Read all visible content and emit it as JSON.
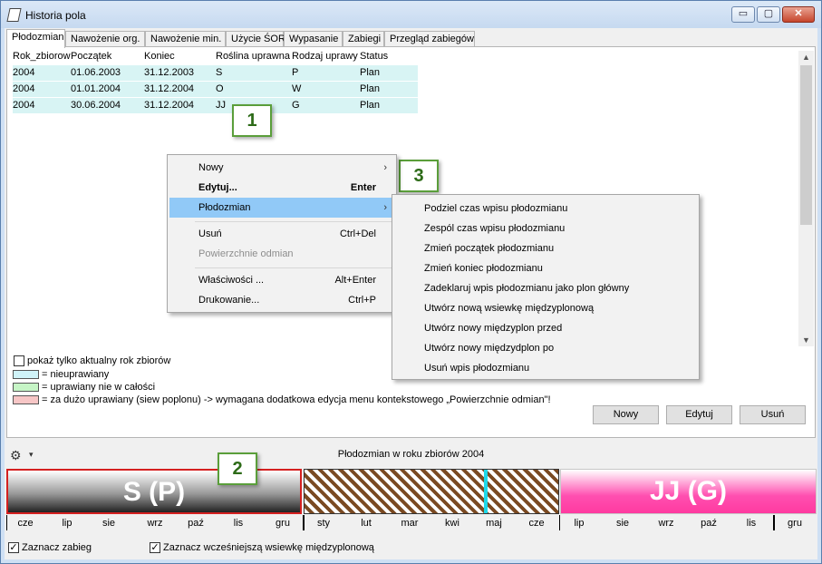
{
  "window": {
    "title": "Historia pola",
    "min_glyph": "▭",
    "max_glyph": "▢",
    "close_glyph": "✕"
  },
  "tabs": [
    {
      "label": "Płodozmian",
      "active": true
    },
    {
      "label": "Nawożenie org."
    },
    {
      "label": "Nawożenie min."
    },
    {
      "label": "Użycie ŚOR"
    },
    {
      "label": "Wypasanie"
    },
    {
      "label": "Zabiegi"
    },
    {
      "label": "Przegląd zabiegów"
    }
  ],
  "table": {
    "columns": [
      "Rok_zbiorow",
      "Początek",
      "Koniec",
      "Roślina uprawna",
      "Rodzaj uprawy",
      "Status"
    ],
    "rows": [
      [
        "2004",
        "01.06.2003",
        "31.12.2003",
        "S",
        "P",
        "Plan"
      ],
      [
        "2004",
        "01.01.2004",
        "31.12.2004",
        "O",
        "W",
        "Plan"
      ],
      [
        "2004",
        "30.06.2004",
        "31.12.2004",
        "JJ",
        "G",
        "Plan"
      ]
    ],
    "row_color": "#d8f4f4"
  },
  "markers": {
    "m1": "1",
    "m2": "2",
    "m3": "3"
  },
  "context_menu": {
    "items": [
      {
        "label": "Nowy",
        "shortcut": "",
        "submenu": true
      },
      {
        "label": "Edytuj...",
        "shortcut": "Enter",
        "bold": true
      },
      {
        "label": "Płodozmian",
        "shortcut": "",
        "submenu": true,
        "highlighted": true
      },
      {
        "label": "Usuń",
        "shortcut": "Ctrl+Del"
      },
      {
        "label": "Powierzchnie odmian",
        "shortcut": "",
        "disabled": true
      },
      {
        "label": "Właściwości ...",
        "shortcut": "Alt+Enter"
      },
      {
        "label": "Drukowanie...",
        "shortcut": "Ctrl+P"
      }
    ],
    "submenu_arrow": "›"
  },
  "submenu": {
    "items": [
      "Podziel czas wpisu płodozmianu",
      "Zespól czas wpisu płodozmianu",
      "Zmień początek płodozmianu",
      "Zmień koniec płodozmianu",
      "Zadeklaruj wpis płodozmianu jako plon główny",
      "Utwórz nową wsiewkę międzyplonową",
      "Utwórz nowy międzyplon przed",
      "Utwórz nowy międzydplon po",
      "Usuń wpis płodozmianu"
    ]
  },
  "options": {
    "current_year_only": "pokaż tylko aktualny rok zbiorów",
    "current_year_checked": false
  },
  "legend": [
    {
      "color": "#cff3f8",
      "text": "= nieuprawiany"
    },
    {
      "color": "#c6f5c6",
      "text": "= uprawiany nie w całości"
    },
    {
      "color": "#f7c6c6",
      "text": "= za dużo uprawiany (siew poplonu) -> wymagana dodatkowa edycja menu kontekstowego „Powierzchnie odmian\"!"
    }
  ],
  "buttons": {
    "new": "Nowy",
    "edit": "Edytuj",
    "delete": "Usuń"
  },
  "timeline": {
    "title": "Płodozmian w roku zbiorów 2004",
    "settings_glyph": "⚙",
    "dropdown_glyph": "▾",
    "block1": {
      "label": "S (P)"
    },
    "block3": {
      "label": "JJ (G)"
    },
    "months": [
      "cze",
      "lip",
      "sie",
      "wrz",
      "paź",
      "lis",
      "gru",
      "sty",
      "lut",
      "mar",
      "kwi",
      "maj",
      "cze",
      "lip",
      "sie",
      "wrz",
      "paź",
      "lis",
      "gru"
    ]
  },
  "checkboxes": {
    "mark_treatment": "Zaznacz zabieg",
    "mark_treatment_checked": true,
    "mark_earlier": "Zaznacz wcześniejszą wsiewkę międzyplonową",
    "mark_earlier_checked": true
  }
}
